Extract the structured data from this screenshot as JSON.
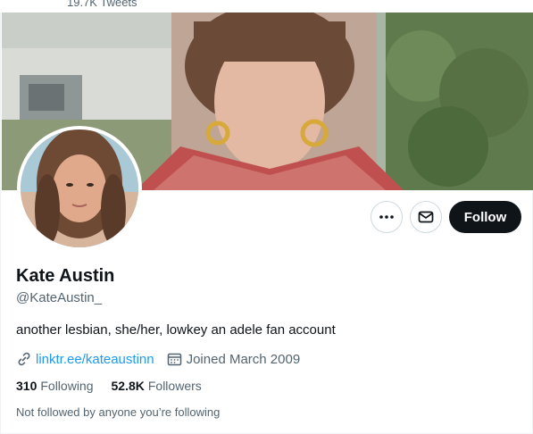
{
  "header": {
    "tweets_count": "19.7K Tweets"
  },
  "profile": {
    "name": "Kate Austin",
    "handle": "@KateAustin_",
    "bio": "another lesbian, she/her, lowkey an adele fan account",
    "link": "linktr.ee/kateaustinn",
    "joined": "Joined March 2009",
    "following_count": "310",
    "following_label": "Following",
    "followers_count": "52.8K",
    "followers_label": "Followers",
    "not_followed_text": "Not followed by anyone you’re following"
  },
  "actions": {
    "more_icon": "more-horizontal-icon",
    "message_icon": "mail-icon",
    "follow_label": "Follow"
  },
  "colors": {
    "link": "#1d9bf0",
    "secondary_text": "#536471",
    "follow_button_bg": "#0f1419"
  }
}
